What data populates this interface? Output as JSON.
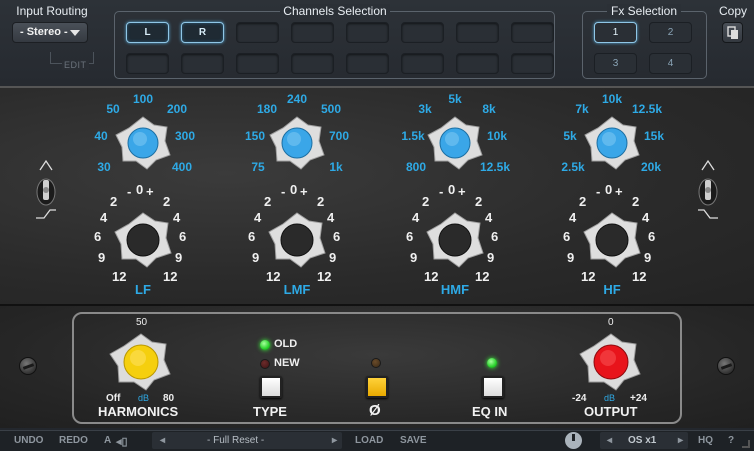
{
  "input_routing": {
    "title": "Input Routing",
    "value": "- Stereo -",
    "edit": "EDIT"
  },
  "channels": {
    "title": "Channels Selection",
    "buttons": [
      "L",
      "R"
    ]
  },
  "fx": {
    "title": "Fx Selection",
    "buttons": [
      "1",
      "2",
      "3",
      "4"
    ],
    "active": "1"
  },
  "copy": {
    "title": "Copy"
  },
  "eq_bands": [
    {
      "name": "LF",
      "freqs": [
        "30",
        "40",
        "50",
        "100",
        "200",
        "300",
        "400"
      ]
    },
    {
      "name": "LMF",
      "freqs": [
        "75",
        "150",
        "180",
        "240",
        "500",
        "700",
        "1k"
      ]
    },
    {
      "name": "HMF",
      "freqs": [
        "800",
        "1.5k",
        "3k",
        "5k",
        "8k",
        "10k",
        "12.5k"
      ]
    },
    {
      "name": "HF",
      "freqs": [
        "2.5k",
        "5k",
        "7k",
        "10k",
        "12.5k",
        "15k",
        "20k"
      ]
    }
  ],
  "gain_scale": {
    "minus": "-",
    "zero": "0",
    "plus": "+",
    "l1": "2",
    "l2": "4",
    "l3": "6",
    "l4": "9",
    "l5": "12"
  },
  "harmonics": {
    "label": "HARMONICS",
    "top": "50",
    "min": "Off",
    "unit": "dB",
    "max": "80",
    "color": "#f5cf0e"
  },
  "type": {
    "label": "TYPE",
    "old": "OLD",
    "new": "NEW"
  },
  "phase": {
    "label": "Ø"
  },
  "eq_in": {
    "label": "EQ IN"
  },
  "output": {
    "label": "OUTPUT",
    "top": "0",
    "min": "-24",
    "unit": "dB",
    "max": "+24",
    "color": "#e8141b"
  },
  "bottom": {
    "undo": "UNDO",
    "redo": "REDO",
    "a": "A",
    "preset": "- Full Reset -",
    "load": "LOAD",
    "save": "SAVE",
    "os": "OS x1",
    "hq": "HQ",
    "help": "?"
  },
  "colors": {
    "accent_blue": "#2eaae6",
    "knob_blue": "#3aa6e8"
  }
}
